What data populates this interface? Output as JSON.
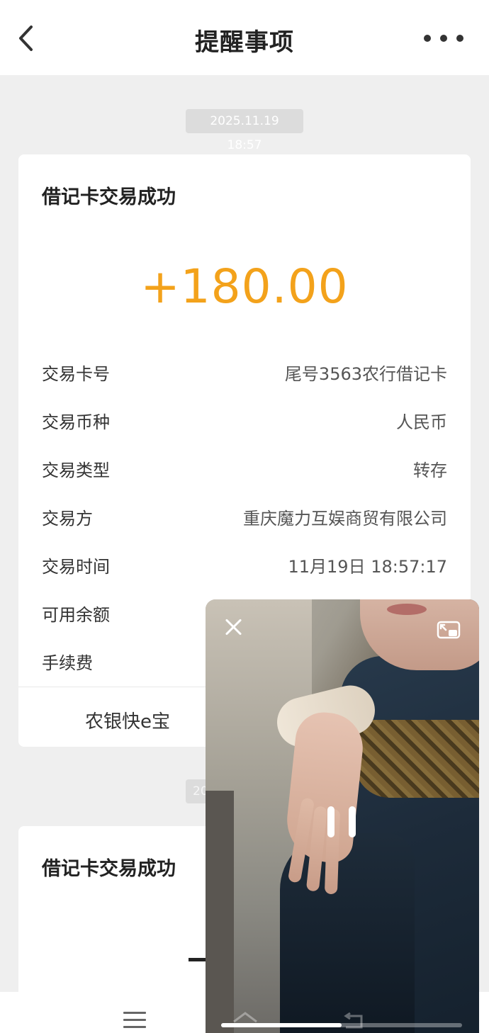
{
  "navbar": {
    "title": "提醒事项",
    "back_icon": "chevron-left-icon",
    "more_icon": "more-horizontal-icon"
  },
  "messages": [
    {
      "timestamp": "2025.11.19 18:57",
      "title": "借记卡交易成功",
      "amount": "+180.00",
      "amount_color": "#f3a21b",
      "fields": [
        {
          "label": "交易卡号",
          "value": "尾号3563农行借记卡"
        },
        {
          "label": "交易币种",
          "value": "人民币"
        },
        {
          "label": "交易类型",
          "value": "转存"
        },
        {
          "label": "交易方",
          "value": "重庆魔力互娱商贸有限公司"
        },
        {
          "label": "交易时间",
          "value": "11月19日 18:57:17"
        },
        {
          "label": "可用余额",
          "value": ""
        },
        {
          "label": "手续费",
          "value": ""
        }
      ],
      "footer_link": "农银快e宝"
    },
    {
      "timestamp": "20",
      "title": "借记卡交易成功"
    }
  ],
  "bottom_bar": {
    "menu_icon": "hamburger-menu-icon"
  },
  "video_player": {
    "close_icon": "close-icon",
    "restore_icon": "restore-window-icon",
    "pause_icon": "pause-icon",
    "progress": 0.5
  }
}
